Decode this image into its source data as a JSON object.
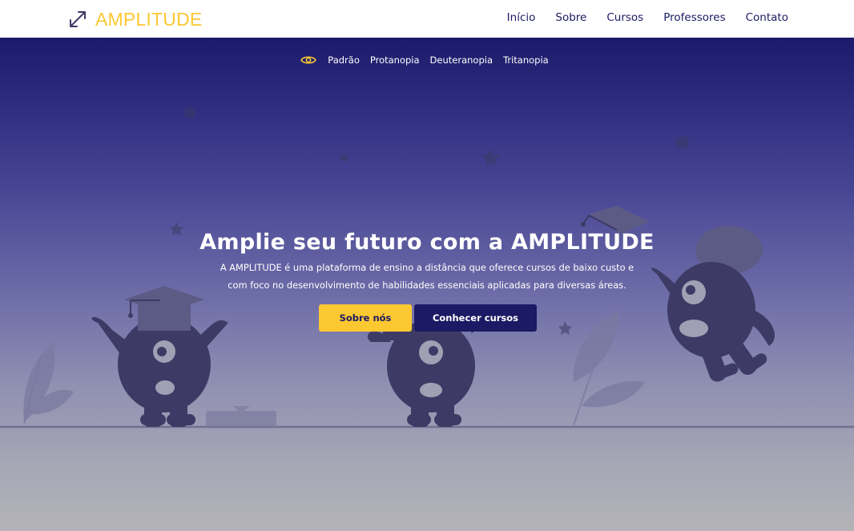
{
  "brand": {
    "name": "AMPLITUDE"
  },
  "nav": {
    "items": [
      {
        "label": "Início"
      },
      {
        "label": "Sobre"
      },
      {
        "label": "Cursos"
      },
      {
        "label": "Professores"
      },
      {
        "label": "Contato"
      }
    ]
  },
  "accessibility": {
    "filters": [
      {
        "label": "Padrão"
      },
      {
        "label": "Protanopia"
      },
      {
        "label": "Deuteranopia"
      },
      {
        "label": "Tritanopia"
      }
    ]
  },
  "hero": {
    "title": "Amplie seu futuro com a AMPLITUDE",
    "description": "A AMPLITUDE é uma plataforma de ensino a distância que oferece cursos de baixo custo e com foco no desenvolvimento de habilidades essenciais aplicadas para diversas áreas.",
    "primary_button": "Sobre nós",
    "secondary_button": "Conhecer cursos"
  },
  "colors": {
    "accent": "#fcc832",
    "brand_dark": "#1c1a64",
    "hero_top": "#1c1a6a",
    "hero_bottom": "#b3b3b7",
    "illustration": "#3d3b65"
  },
  "icons": {
    "logo": "expand-arrows-icon",
    "filter": "eye-icon"
  }
}
